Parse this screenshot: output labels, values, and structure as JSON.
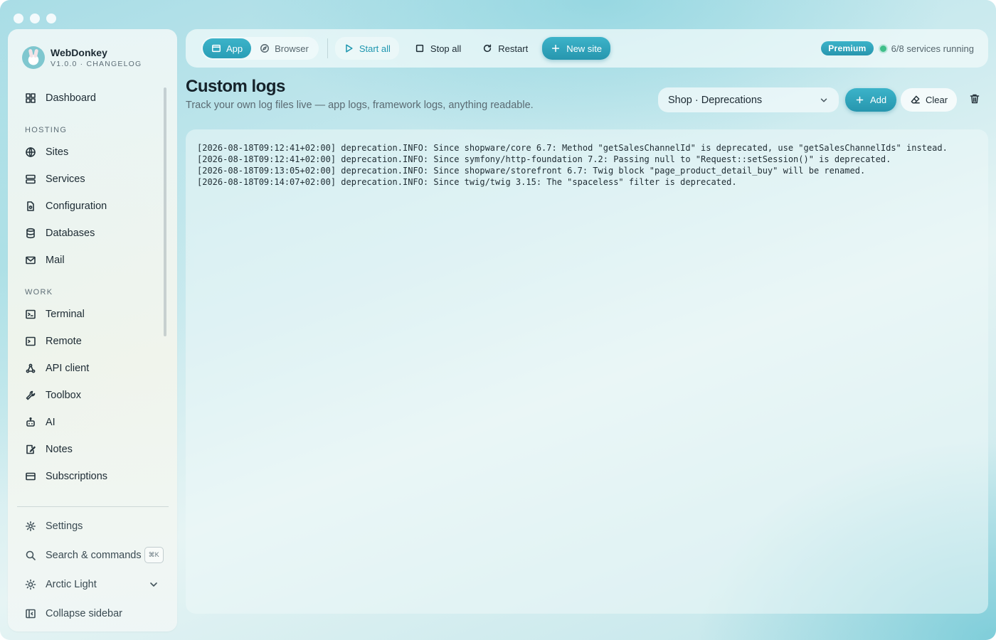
{
  "app": {
    "name": "WebDonkey",
    "version_line": "V1.0.0 · CHANGELOG"
  },
  "sidebar": {
    "items": [
      {
        "label": "Dashboard",
        "icon": "dashboard-icon"
      },
      {
        "section": "HOSTING"
      },
      {
        "label": "Sites",
        "icon": "globe-icon"
      },
      {
        "label": "Services",
        "icon": "server-icon"
      },
      {
        "label": "Configuration",
        "icon": "config-file-icon"
      },
      {
        "label": "Databases",
        "icon": "database-icon"
      },
      {
        "label": "Mail",
        "icon": "mail-icon"
      },
      {
        "section": "WORK"
      },
      {
        "label": "Terminal",
        "icon": "terminal-icon"
      },
      {
        "label": "Remote",
        "icon": "remote-terminal-icon"
      },
      {
        "label": "API client",
        "icon": "api-icon"
      },
      {
        "label": "Toolbox",
        "icon": "wrench-icon"
      },
      {
        "label": "AI",
        "icon": "robot-icon"
      },
      {
        "label": "Notes",
        "icon": "notes-icon"
      },
      {
        "label": "Subscriptions",
        "icon": "credit-card-icon"
      }
    ],
    "footer": {
      "settings": "Settings",
      "search": "Search & commands",
      "search_shortcut": "⌘K",
      "theme": "Arctic Light",
      "collapse": "Collapse sidebar"
    }
  },
  "toolbar": {
    "view_app": "App",
    "view_browser": "Browser",
    "start_all": "Start all",
    "stop_all": "Stop all",
    "restart": "Restart",
    "new_site": "New site",
    "badge": "Premium",
    "status": "6/8 services running"
  },
  "page": {
    "title": "Custom logs",
    "subtitle": "Track your own log files live — app logs, framework logs, anything readable.",
    "selected_log": "Shop · Deprecations",
    "add_label": "Add",
    "clear_label": "Clear"
  },
  "logs": [
    "[2026-08-18T09:12:41+02:00] deprecation.INFO: Since shopware/core 6.7: Method \"getSalesChannelId\" is deprecated, use \"getSalesChannelIds\" instead.",
    "[2026-08-18T09:12:41+02:00] deprecation.INFO: Since symfony/http-foundation 7.2: Passing null to \"Request::setSession()\" is deprecated.",
    "[2026-08-18T09:13:05+02:00] deprecation.INFO: Since shopware/storefront 6.7: Twig block \"page_product_detail_buy\" will be renamed.",
    "[2026-08-18T09:14:07+02:00] deprecation.INFO: Since twig/twig 3.15: The \"spaceless\" filter is deprecated."
  ],
  "colors": {
    "accent": "#2a9eb6",
    "status_ok": "#3fbf8a"
  }
}
